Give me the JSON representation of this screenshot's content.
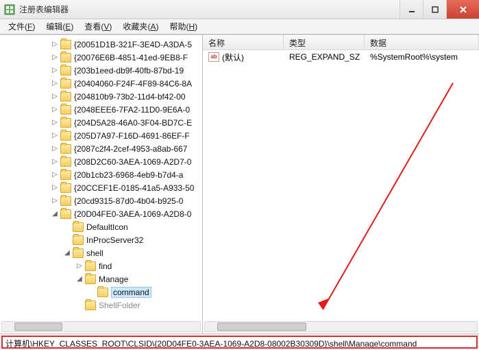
{
  "window": {
    "title": "注册表编辑器"
  },
  "menubar": [
    {
      "label": "文件",
      "hotkey": "F"
    },
    {
      "label": "编辑",
      "hotkey": "E"
    },
    {
      "label": "查看",
      "hotkey": "V"
    },
    {
      "label": "收藏夹",
      "hotkey": "A"
    },
    {
      "label": "帮助",
      "hotkey": "H"
    }
  ],
  "tree": {
    "roots": [
      {
        "label": "{20051D1B-321F-3E4D-A3DA-5",
        "expander": "▷",
        "indent": 0
      },
      {
        "label": "{20076E6B-4851-41ed-9EB8-F",
        "expander": "▷",
        "indent": 0
      },
      {
        "label": "{203b1eed-db9f-40fb-87bd-19",
        "expander": "▷",
        "indent": 0
      },
      {
        "label": "{20404060-F24F-4F89-84C6-8A",
        "expander": "▷",
        "indent": 0
      },
      {
        "label": "{204810b9-73b2-11d4-bf42-00",
        "expander": "▷",
        "indent": 0
      },
      {
        "label": "{2048EEE6-7FA2-11D0-9E6A-0",
        "expander": "▷",
        "indent": 0
      },
      {
        "label": "{204D5A28-46A0-3F04-BD7C-E",
        "expander": "▷",
        "indent": 0
      },
      {
        "label": "{205D7A97-F16D-4691-86EF-F",
        "expander": "▷",
        "indent": 0
      },
      {
        "label": "{2087c2f4-2cef-4953-a8ab-667",
        "expander": "▷",
        "indent": 0
      },
      {
        "label": "{208D2C60-3AEA-1069-A2D7-0",
        "expander": "▷",
        "indent": 0
      },
      {
        "label": "{20b1cb23-6968-4eb9-b7d4-a",
        "expander": "▷",
        "indent": 0
      },
      {
        "label": "{20CCEF1E-0185-41a5-A933-50",
        "expander": "▷",
        "indent": 0
      },
      {
        "label": "{20cd9315-87d0-4b04-b925-0",
        "expander": "▷",
        "indent": 0
      },
      {
        "label": "{20D04FE0-3AEA-1069-A2D8-0",
        "expander": "◢",
        "indent": 0,
        "children": [
          {
            "label": "DefaultIcon",
            "expander": "",
            "indent": 1
          },
          {
            "label": "InProcServer32",
            "expander": "",
            "indent": 1
          },
          {
            "label": "shell",
            "expander": "◢",
            "indent": 1,
            "children": [
              {
                "label": "find",
                "expander": "▷",
                "indent": 2
              },
              {
                "label": "Manage",
                "expander": "◢",
                "indent": 2,
                "children": [
                  {
                    "label": "command",
                    "expander": "",
                    "indent": 3,
                    "selected": true
                  }
                ]
              },
              {
                "label": "ShellFolder",
                "expander": "",
                "indent": 2,
                "cut": true
              }
            ]
          }
        ]
      }
    ]
  },
  "list": {
    "columns": {
      "name": "名称",
      "type": "类型",
      "data": "数据"
    },
    "rows": [
      {
        "icon": "ab",
        "name": "(默认)",
        "type": "REG_EXPAND_SZ",
        "data": "%SystemRoot%\\system"
      }
    ]
  },
  "statusbar": {
    "path": "计算机\\HKEY_CLASSES_ROOT\\CLSID\\{20D04FE0-3AEA-1069-A2D8-08002B30309D}\\shell\\Manage\\command"
  }
}
